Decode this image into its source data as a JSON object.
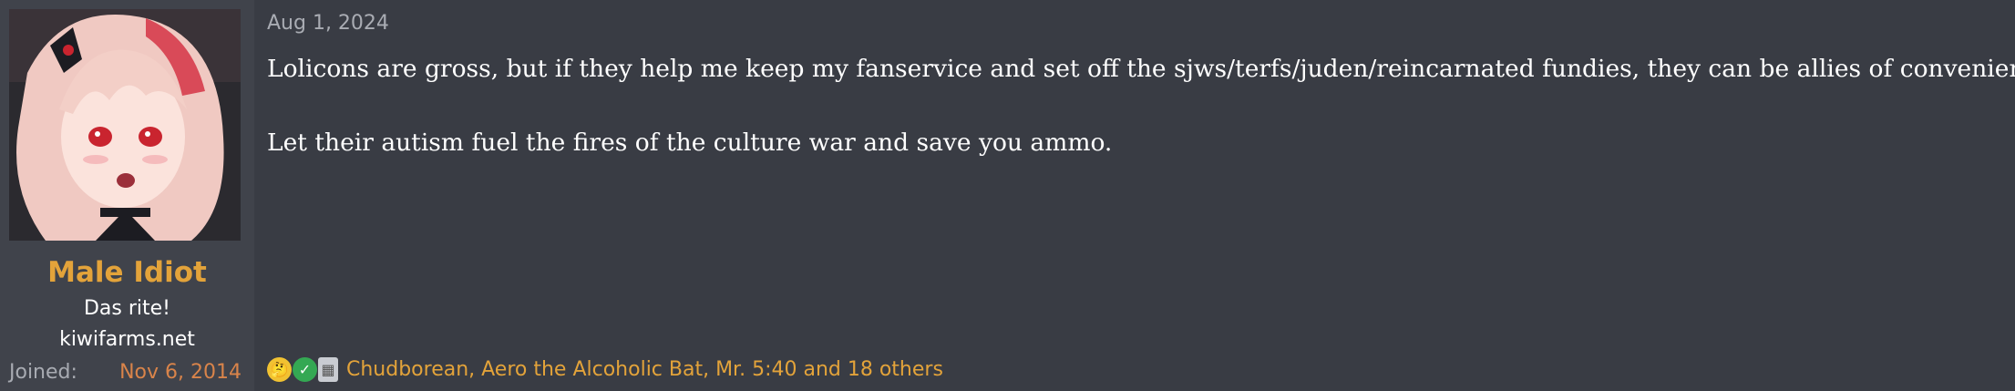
{
  "post": {
    "date": "Aug 1, 2024",
    "paragraphs": [
      "Lolicons are gross, but if they help me keep my fanservice and set off the sjws/terfs/juden/reincarnated fundies, they can be allies of convenience.",
      "Let their autism fuel the fires of the culture war and save you ammo."
    ],
    "reactions": {
      "icons": [
        "thinking-face-icon",
        "check-mark-icon",
        "chart-icon"
      ],
      "text": "Chudborean, Aero the Alcoholic Bat, Mr. 5:40 and 18 others"
    }
  },
  "user": {
    "name": "Male Idiot",
    "title": "Das rite!",
    "site": "kiwifarms.net",
    "joined_label": "Joined:",
    "joined_value": "Nov 6, 2014"
  },
  "colors": {
    "username": "#e3a33a",
    "joined_value": "#d9844a",
    "reaction_text": "#e3a33a",
    "background": "#393c44"
  }
}
